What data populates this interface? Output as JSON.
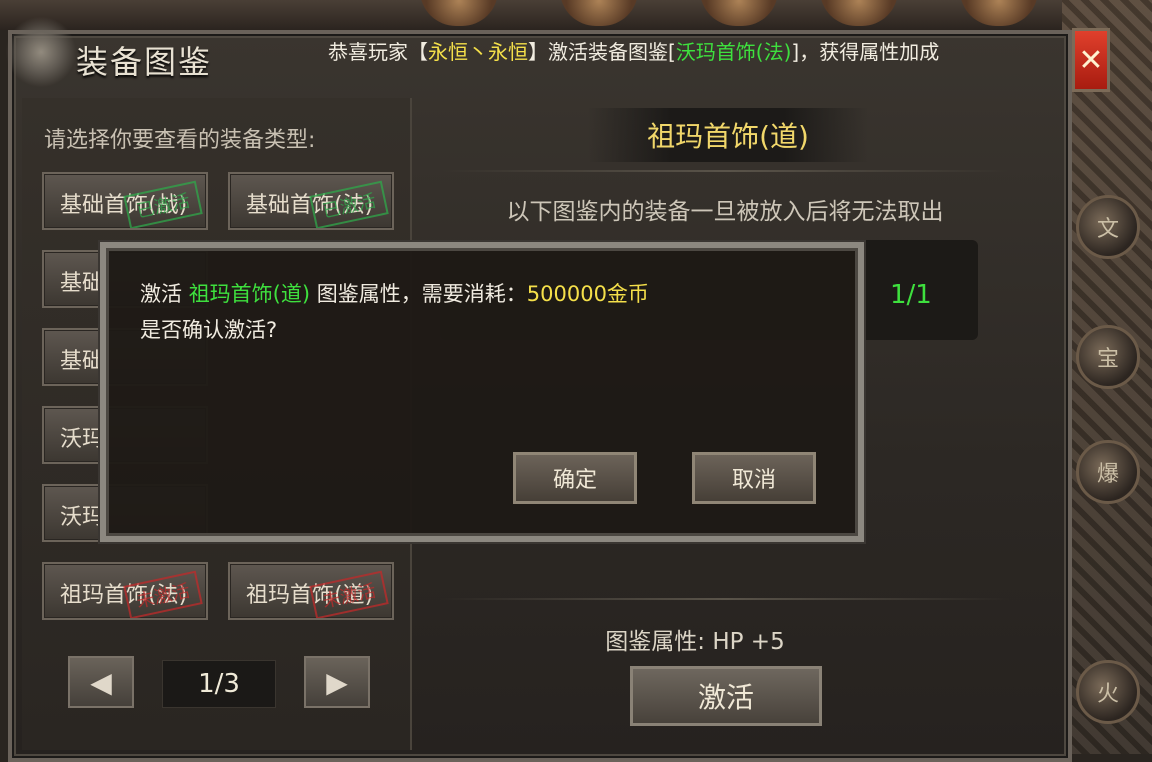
{
  "window": {
    "title": "装备图鉴",
    "close_label": "✕"
  },
  "marquee": {
    "prefix": "恭喜玩家【",
    "player": "永恒丶永恒",
    "middle": "】激活装备图鉴[",
    "item": "沃玛首饰(法)",
    "suffix": "]，获得属性加成"
  },
  "left": {
    "prompt": "请选择你要查看的装备类型:",
    "categories": [
      {
        "label": "基础首饰(战)",
        "stamp": "已激活",
        "status": "on"
      },
      {
        "label": "基础首饰(法)",
        "stamp": "已激活",
        "status": "on"
      },
      {
        "label": "基础",
        "stamp": "",
        "status": ""
      },
      {
        "label": "基础",
        "stamp": "",
        "status": ""
      },
      {
        "label": "沃玛",
        "stamp": "",
        "status": ""
      },
      {
        "label": "沃玛",
        "stamp": "",
        "status": ""
      },
      {
        "label": "祖玛首饰(法)",
        "stamp": "未激活",
        "status": "off"
      },
      {
        "label": "祖玛首饰(道)",
        "stamp": "未激活",
        "status": "off"
      }
    ],
    "pager": {
      "prev": "◀",
      "page": "1/3",
      "next": "▶"
    }
  },
  "right": {
    "item_title": "祖玛首饰(道)",
    "notice": "以下图鉴内的装备一旦被放入后将无法取出",
    "count": "1/1",
    "attr_label": "图鉴属性:",
    "attr_value": "HP +5",
    "activate_label": "激活"
  },
  "modal": {
    "line1_prefix": "激活 ",
    "line1_item": "祖玛首饰(道)",
    "line1_mid": " 图鉴属性，需要消耗：",
    "line1_cost": "500000金币",
    "line2": "是否确认激活?",
    "confirm_label": "确定",
    "cancel_label": "取消"
  },
  "side": {
    "icons": [
      "文",
      "宝",
      "爆",
      "火"
    ]
  }
}
